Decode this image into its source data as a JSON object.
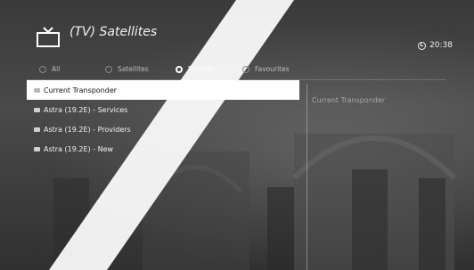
{
  "header": {
    "title": "(TV) Satellites",
    "time": "20:38"
  },
  "tabs": [
    {
      "label": "All",
      "active": false
    },
    {
      "label": "Satellites",
      "active": false
    },
    {
      "label": "Provider",
      "active": true
    },
    {
      "label": "Favourites",
      "active": false
    }
  ],
  "list": {
    "items": [
      {
        "label": "Current Transponder",
        "selected": true
      },
      {
        "label": "Astra (19.2E) - Services",
        "selected": false
      },
      {
        "label": "Astra (19.2E) - Providers",
        "selected": false
      },
      {
        "label": "Astra (19.2E) - New",
        "selected": false
      }
    ]
  },
  "info_panel": {
    "text": "Current Transponder"
  },
  "icons": {
    "tv": "tv-icon",
    "clock": "clock-icon",
    "folder": "folder-icon"
  }
}
